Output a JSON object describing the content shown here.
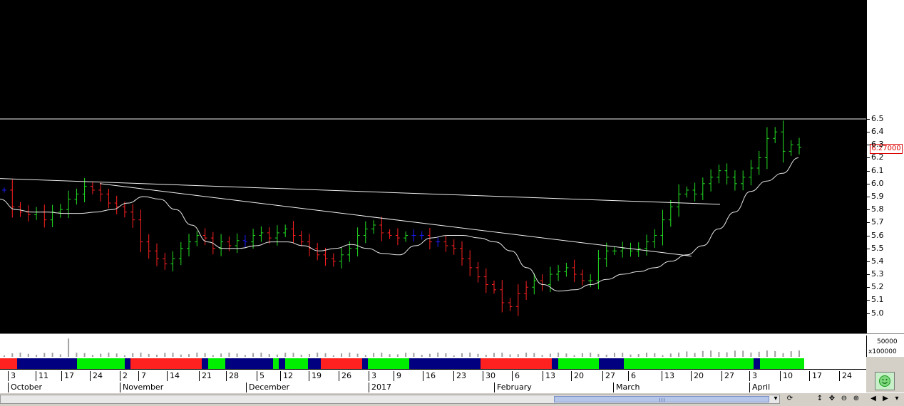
{
  "chart_data": {
    "type": "bar",
    "subtype": "ohlc-price-chart",
    "title": "",
    "y_axis": {
      "ticks": [
        "5.0",
        "5.1",
        "5.2",
        "5.3",
        "5.4",
        "5.5",
        "5.6",
        "5.7",
        "5.8",
        "5.9",
        "6.0",
        "6.1",
        "6.2",
        "6.3",
        "6.4",
        "6.5"
      ],
      "range": [
        4.9,
        6.6
      ],
      "last_price_label": "6.27000"
    },
    "volume_axis": {
      "tick_label": "50000",
      "unit_label": "x100000"
    },
    "x_axis": {
      "day_labels": [
        "3",
        "11",
        "17",
        "24",
        "2",
        "7",
        "14",
        "21",
        "28",
        "5",
        "12",
        "19",
        "26",
        "3",
        "9",
        "16",
        "23",
        "30",
        "6",
        "13",
        "20",
        "27",
        "6",
        "13",
        "20",
        "27",
        "3",
        "10",
        "17",
        "24"
      ],
      "month_labels": [
        "October",
        "November",
        "December",
        "2017",
        "February",
        "March",
        "April"
      ]
    },
    "series": [
      {
        "close": [
          5.95,
          5.82,
          5.78,
          5.76,
          5.78,
          5.72,
          5.78,
          5.8,
          5.88,
          5.92,
          5.98,
          5.95,
          5.92,
          5.85,
          5.82,
          5.78,
          5.72,
          5.55,
          5.48,
          5.42,
          5.38,
          5.42,
          5.5,
          5.55,
          5.6,
          5.58,
          5.5,
          5.55,
          5.52,
          5.56,
          5.55,
          5.6,
          5.62,
          5.58,
          5.62,
          5.65,
          5.6,
          5.55,
          5.5,
          5.45,
          5.42,
          5.4,
          5.45,
          5.5,
          5.6,
          5.65,
          5.68,
          5.62,
          5.6,
          5.58,
          5.6,
          5.6,
          5.6,
          5.55,
          5.55,
          5.52,
          5.5,
          5.42,
          5.35,
          5.28,
          5.22,
          5.18,
          5.08,
          5.05,
          5.15,
          5.2,
          5.25,
          5.22,
          5.3,
          5.32,
          5.35,
          5.3,
          5.25,
          5.25,
          5.42,
          5.48,
          5.48,
          5.5,
          5.48,
          5.5,
          5.55,
          5.6,
          5.72,
          5.82,
          5.92,
          5.95,
          5.92,
          6.0,
          6.05,
          6.1,
          6.05,
          6.0,
          6.05,
          6.12,
          6.2,
          6.35,
          6.4,
          6.25,
          6.3,
          6.28
        ]
      },
      {
        "trend": [
          5.88,
          5.8,
          5.78,
          5.78,
          5.77,
          5.77,
          5.78,
          5.8,
          5.85,
          5.9,
          5.88,
          5.8,
          5.68,
          5.55,
          5.5,
          5.5,
          5.52,
          5.55,
          5.55,
          5.52,
          5.48,
          5.5,
          5.53,
          5.5,
          5.46,
          5.45,
          5.52,
          5.58,
          5.6,
          5.6,
          5.58,
          5.55,
          5.48,
          5.35,
          5.22,
          5.17,
          5.18,
          5.22,
          5.26,
          5.3,
          5.32,
          5.35,
          5.4,
          5.45,
          5.52,
          5.65,
          5.78,
          5.94,
          6.02,
          6.08,
          6.2
        ]
      }
    ]
  },
  "ui": {
    "bottom_icons": [
      "refresh-icon",
      "move-vertical-icon",
      "move-icon",
      "zoom-out-icon",
      "zoom-in-icon",
      "left-arrow-icon",
      "right-arrow-icon",
      "dropdown-arrow-icon"
    ]
  }
}
